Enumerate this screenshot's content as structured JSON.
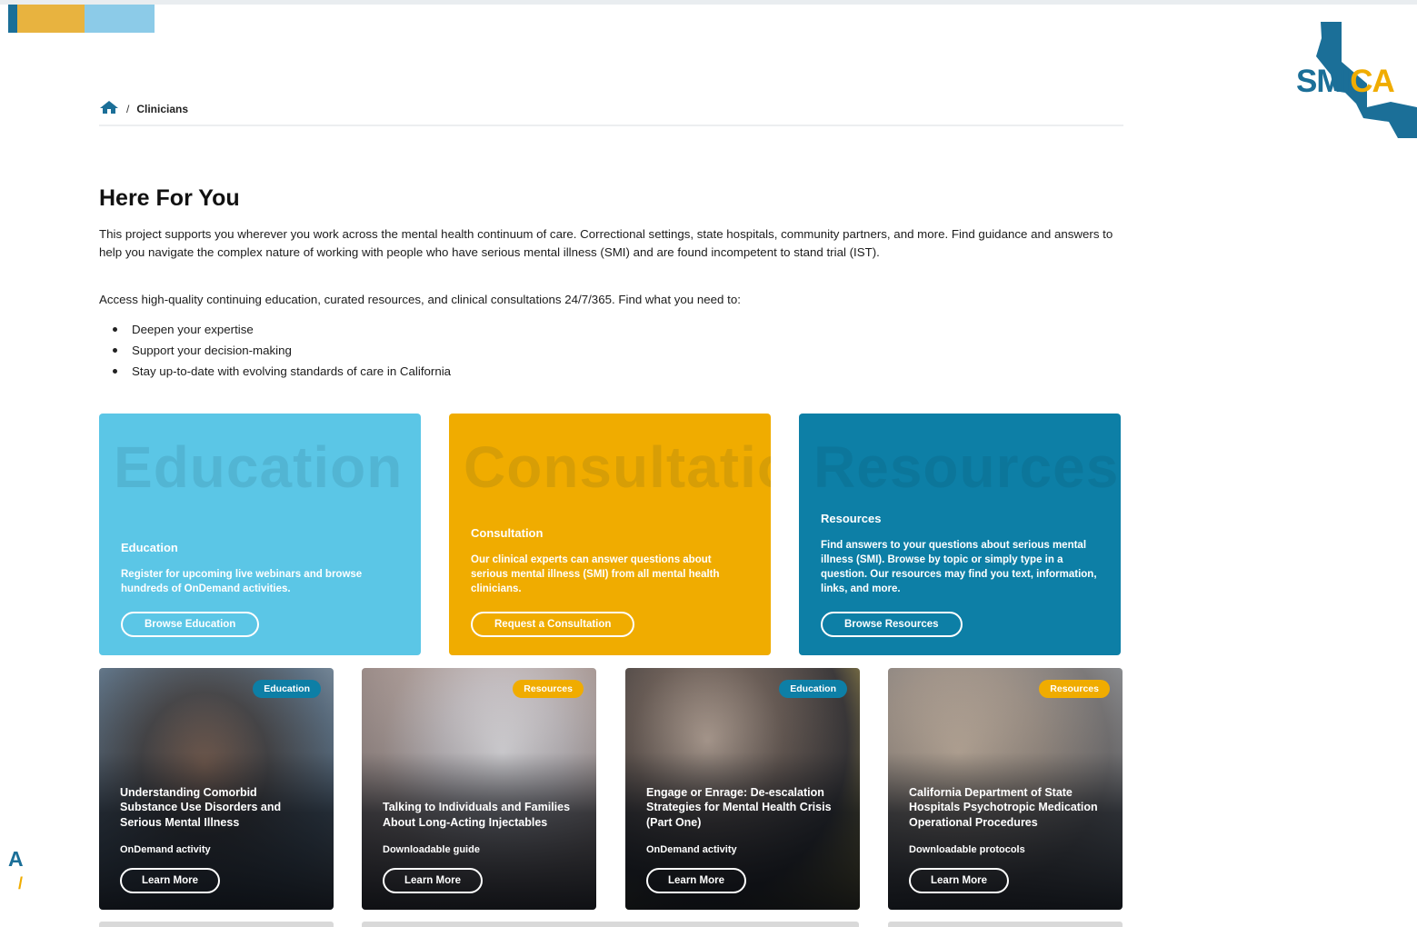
{
  "brand": {
    "logo_text_a": "SMI",
    "logo_text_b": "CA",
    "color_blue": "#1b6f98",
    "color_orange": "#f0ac00",
    "color_light_blue": "#5bc6e6",
    "color_teal_blue": "#0d7fa6"
  },
  "side_fragment": {
    "a": "A",
    "b": "/"
  },
  "breadcrumb": {
    "home_icon": "home-icon",
    "separator": "/",
    "current": "Clinicians"
  },
  "intro": {
    "title": "Here For You",
    "paragraph1": "This project supports you wherever you work across the mental health continuum of care. Correctional settings, state hospitals, community partners, and more. Find guidance and answers to help you navigate the complex nature of working with people who have serious mental illness (SMI) and are found incompetent to stand trial (IST).",
    "paragraph2": "Access high-quality continuing education, curated resources, and clinical consultations 24/7/365. Find what you need to:",
    "bullets": [
      "Deepen your expertise",
      "Support your decision-making",
      "Stay up-to-date with evolving standards of care in California"
    ]
  },
  "features": [
    {
      "bg_word": "Education",
      "title": "Education",
      "text": "Register for upcoming live webinars and browse hundreds of OnDemand activities.",
      "button": "Browse Education",
      "color": "#5bc6e6"
    },
    {
      "bg_word": "Consultation",
      "title": "Consultation",
      "text": "Our clinical experts can answer questions about serious mental illness (SMI) from all mental health clinicians.",
      "button": "Request a Consultation",
      "color": "#f0ac00"
    },
    {
      "bg_word": "Resources",
      "title": "Resources",
      "text": "Find answers to your questions about serious mental illness (SMI). Browse by topic or simply type in a question. Our resources may find you text, information, links, and more.",
      "button": "Browse Resources",
      "color": "#0d7fa6"
    }
  ],
  "cards": [
    {
      "badge": "Education",
      "badge_color": "#0d7fa6",
      "title": "Understanding Comorbid Substance Use Disorders and Serious Mental Illness",
      "type": "OnDemand activity",
      "button": "Learn More"
    },
    {
      "badge": "Resources",
      "badge_color": "#f0ac00",
      "title": "Talking to Individuals and Families About Long-Acting Injectables",
      "type": "Downloadable guide",
      "button": "Learn More"
    },
    {
      "badge": "Education",
      "badge_color": "#0d7fa6",
      "title": "Engage or Enrage: De-escalation Strategies for Mental Health Crisis (Part One)",
      "type": "OnDemand activity",
      "button": "Learn More"
    },
    {
      "badge": "Resources",
      "badge_color": "#f0ac00",
      "title": "California Department of State Hospitals Psychotropic Medication Operational Procedures",
      "type": "Downloadable protocols",
      "button": "Learn More"
    }
  ]
}
